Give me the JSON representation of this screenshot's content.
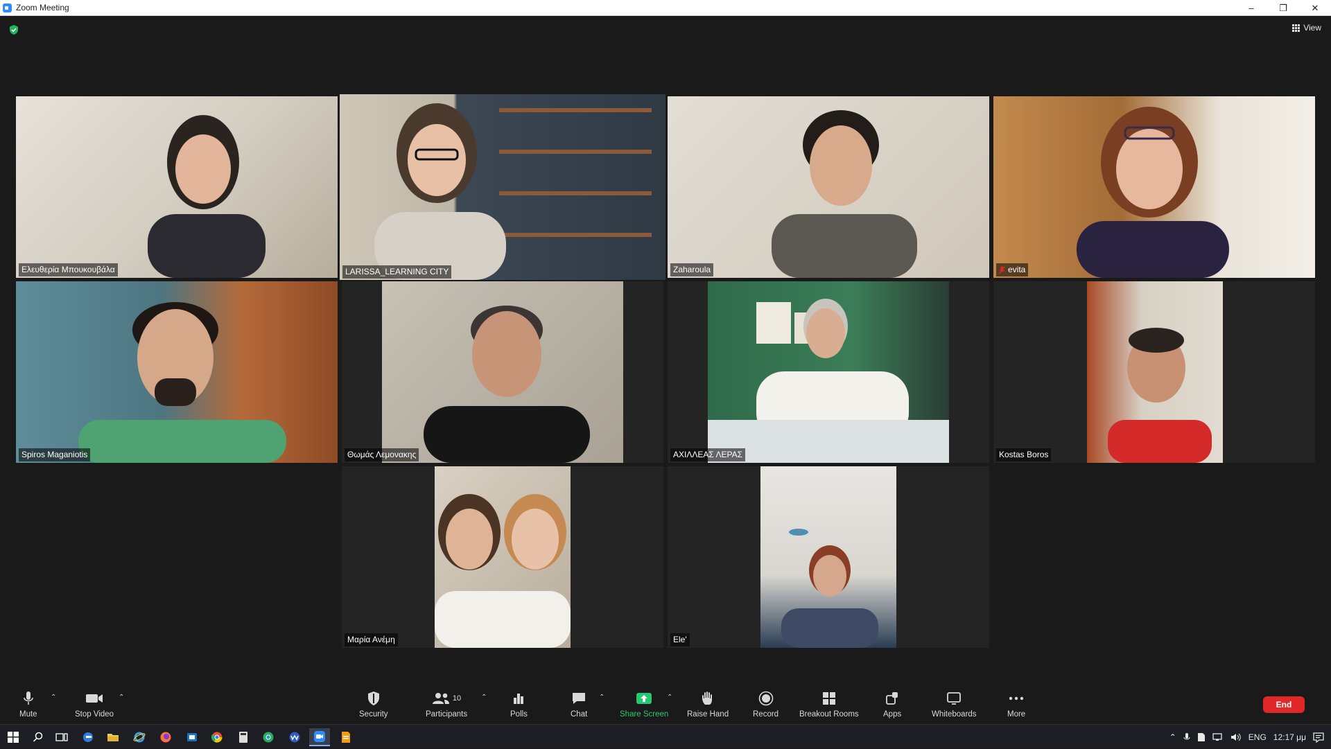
{
  "window": {
    "title": "Zoom Meeting",
    "controls": [
      "–",
      "❐",
      "✕"
    ]
  },
  "meeting": {
    "security_indicator": "shield-check",
    "view_label": "View",
    "active_speaker": "LARISSA_LEARNING CITY",
    "participants": [
      {
        "name": "Ελευθερία Μπουκουβάλα",
        "muted": false,
        "bg": "#d7d2c6"
      },
      {
        "name": "LARISSA_LEARNING CITY",
        "muted": false,
        "bg": "#3e4a56"
      },
      {
        "name": "Zaharoula",
        "muted": false,
        "bg": "#d3cbbd"
      },
      {
        "name": "evita",
        "muted": true,
        "bg": "#b9824a"
      },
      {
        "name": "Spiros Maganiotis",
        "muted": false,
        "bg": "#3f6c7a"
      },
      {
        "name": "Θωμάς Λεμονακης",
        "muted": false,
        "bg": "#bfbab0"
      },
      {
        "name": "ΑΧΙΛΛΕΑΣ ΛΕΡΑΣ",
        "muted": false,
        "bg": "#2f6a4a"
      },
      {
        "name": "Kostas Boros",
        "muted": false,
        "bg": "#c9c0b2"
      },
      {
        "name": "Μαρία Ανέμη",
        "muted": false,
        "bg": "#d8cfc2"
      },
      {
        "name": "Ele'",
        "muted": false,
        "bg": "#e0dcd6"
      }
    ]
  },
  "toolbar": {
    "mute": "Mute",
    "stop_video": "Stop Video",
    "security": "Security",
    "participants": "Participants",
    "participants_count": "10",
    "polls": "Polls",
    "chat": "Chat",
    "share_screen": "Share Screen",
    "raise_hand": "Raise Hand",
    "record": "Record",
    "breakout_rooms": "Breakout Rooms",
    "apps": "Apps",
    "whiteboards": "Whiteboards",
    "more": "More",
    "end": "End",
    "share_color": "#28c76f",
    "end_color": "#e02828"
  },
  "taskbar": {
    "language": "ENG",
    "time": "12:17 μμ"
  }
}
